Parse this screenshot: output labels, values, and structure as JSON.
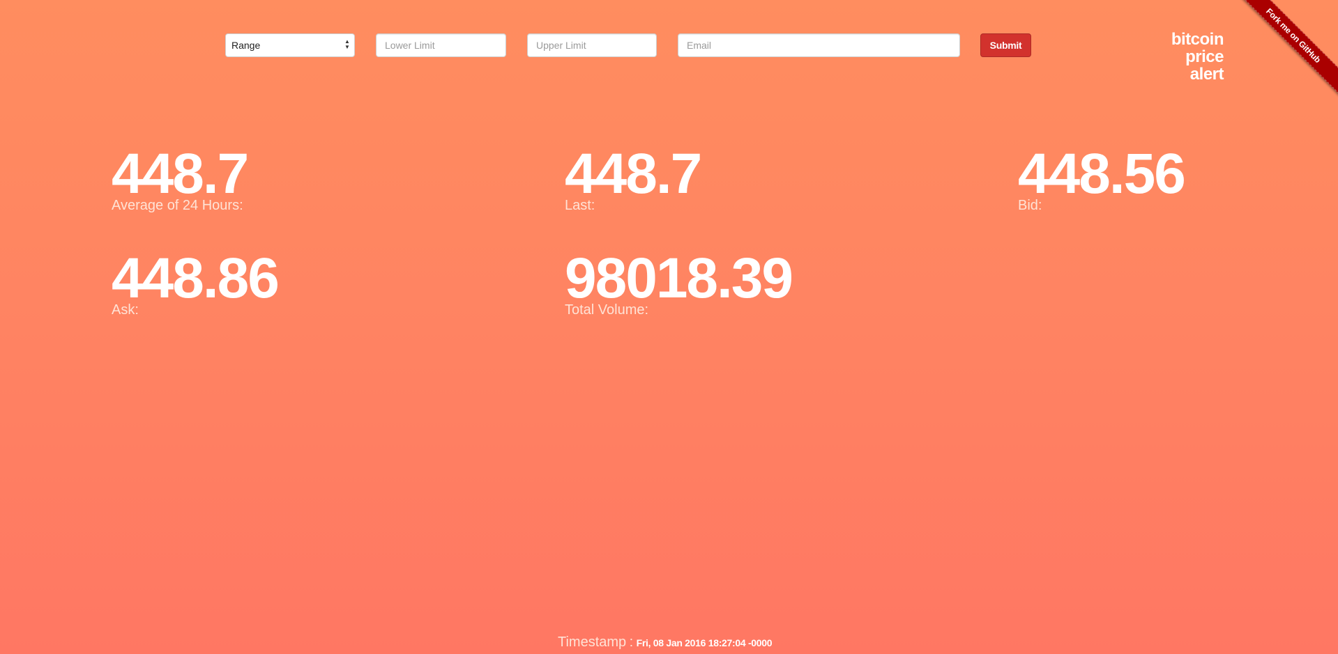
{
  "form": {
    "select_value": "Range",
    "lower_placeholder": "Lower Limit",
    "upper_placeholder": "Upper Limit",
    "email_placeholder": "Email",
    "submit_label": "Submit"
  },
  "brand": {
    "line1": "bitcoin",
    "line2": "price",
    "line3": "alert"
  },
  "ribbon": {
    "text": "Fork me on GitHub"
  },
  "stats": {
    "average": {
      "value": "448.7",
      "label": "Average of 24 Hours:"
    },
    "last": {
      "value": "448.7",
      "label": "Last:"
    },
    "bid": {
      "value": "448.56",
      "label": "Bid:"
    },
    "ask": {
      "value": "448.86",
      "label": "Ask:"
    },
    "volume": {
      "value": "98018.39",
      "label": "Total Volume:"
    }
  },
  "timestamp": {
    "label": "Timestamp",
    "separator": ":",
    "value": "Fri, 08 Jan 2016 18:27:04 -0000"
  },
  "icons": {
    "select_caret": "up-down-caret-icon"
  },
  "colors": {
    "background_top": "#ff8d5f",
    "background_bottom": "#ff7763",
    "submit_button": "#d2322d",
    "ribbon": "#aa0000"
  }
}
